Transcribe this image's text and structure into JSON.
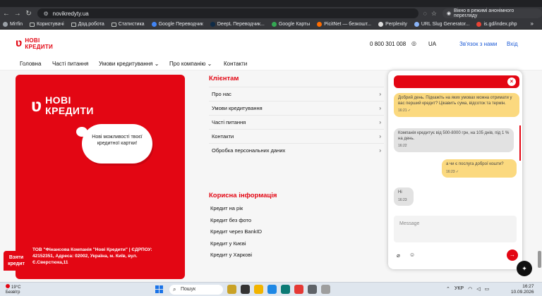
{
  "browser": {
    "url": "novikredyty.ua",
    "incognito_text": "Вікно в режимі анонімного перегляду",
    "bookmarks": [
      "Мітfin",
      "Користувачі",
      "Дод.робота",
      "Статистика",
      "Google Переводчик",
      "DeepL Переводчик...",
      "Google Карты",
      "PicitNet — безкошт...",
      "Perplexity",
      "URL Slug Generator...",
      "is.gd/index.php"
    ],
    "bookmarks_more": "»"
  },
  "header": {
    "logo_line1": "НОВІ",
    "logo_line2": "КРЕДИТИ",
    "phone": "0 800 301 008",
    "lang": "UA",
    "contact": "Зв'язок з нами",
    "login": "Вхід"
  },
  "nav": [
    "Головна",
    "Часті питання",
    "Умови кредитування ⌄",
    "Про компанію ⌄",
    "Контакти"
  ],
  "card": {
    "logo_line1": "НОВІ",
    "logo_line2": "КРЕДИТИ",
    "cloud": "Нові можливості твоєї кредитної картки!",
    "company": "ТОВ \"Фінансова Компанія \"Нові Кредити\" | ЄДРПОУ: 42152351, Адреса: 02002, Україна, м. Київ, вул. Є.Сверстюка,11"
  },
  "clients": {
    "title": "Клієнтам",
    "items": [
      "Про нас",
      "Умови кредитування",
      "Часті питання",
      "Контакти",
      "Обробка персональних даних"
    ]
  },
  "useful": {
    "title": "Корисна інформація",
    "items": [
      "Кредит на рік",
      "Кредит без фото",
      "Кредит через BankID",
      "Кредит у Києві",
      "Кредит у Харкові"
    ]
  },
  "take_credit": "Взяти кредит",
  "chat": {
    "messages": [
      {
        "text": "Добрий день. Підкажіть на яких умовах можна отримати у вас перший кредит? Цікавить сума, відсоток та термін.",
        "time": "16:21 ✓"
      },
      {
        "text": "Компанія кредитує від 500-8000 грн, на 105 днів, під 1 % на день.",
        "time": "16:22"
      },
      {
        "text": "а чи є послуга доброї кошти?",
        "time": "16:23 ✓"
      },
      {
        "text": "Hi",
        "time": "16:23"
      }
    ],
    "placeholder": "Message"
  },
  "taskbar": {
    "temp": "19°C",
    "weather": "Безвітр",
    "search": "Пошук",
    "lang": "УКР",
    "time": "16:27",
    "date": "10.09.2026"
  },
  "colors": {
    "brand_red": "#e30613",
    "bubble_yellow": "#fbd97f",
    "link_blue": "#1d5bd6"
  }
}
